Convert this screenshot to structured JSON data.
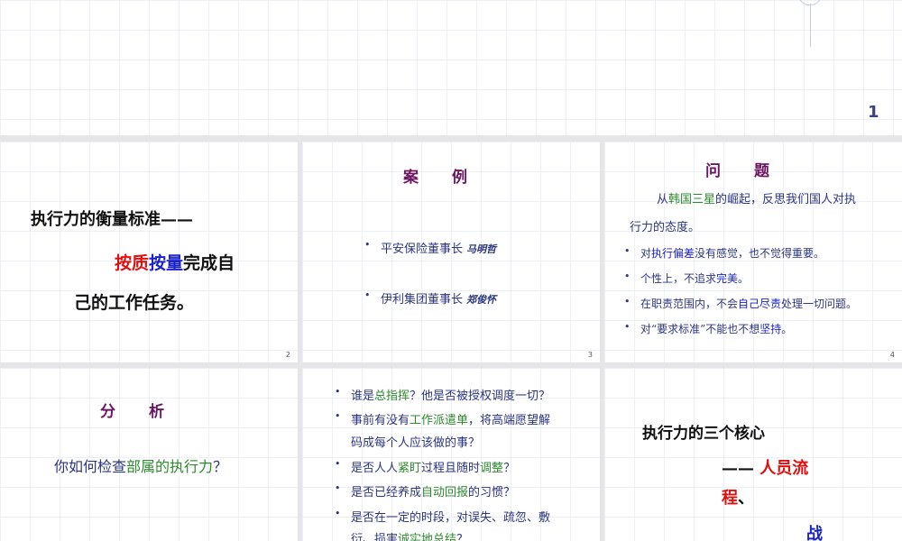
{
  "slides": [
    {
      "number": "1"
    },
    {
      "number": "2",
      "heading": "执行力的衡量标准——",
      "line2": [
        {
          "t": "按质"
        },
        {
          "t": "按量"
        },
        {
          "t": "完成自"
        }
      ],
      "line3": "己的工作任务。"
    },
    {
      "number": "3",
      "title": "案　　例",
      "items": [
        {
          "text": "平安保险董事长",
          "name": "马明哲"
        },
        {
          "text": "伊利集团董事长",
          "name": "郑俊怀"
        }
      ]
    },
    {
      "number": "4",
      "title": "问　　题",
      "intro": [
        "从",
        "韩国三星",
        "的崛起，反思我们国人对执"
      ],
      "intro2": "行力的态度。",
      "items": [
        [
          "对",
          "执行偏差",
          "没有感觉，也不觉得重要。"
        ],
        [
          "个性上，不追求",
          "完美",
          "。"
        ],
        [
          "在职责范围内，不会",
          "自己尽责",
          "处理一切问题。"
        ],
        [
          "对“要求标准”不能也不想",
          "坚持",
          "。"
        ]
      ]
    },
    {
      "title": "分　　析",
      "question": [
        "你如何检查",
        "部属的执行力",
        "？"
      ]
    },
    {
      "items": [
        [
          "谁是",
          "总指挥",
          "？他是否被授权调度一切？"
        ],
        [
          "事前有没有",
          "工作派遣单",
          "，将高端愿望解"
        ],
        [
          "码成每个人应该做的事？"
        ],
        [
          "是否人人",
          "紧盯",
          "过程且随时",
          "调整",
          "？"
        ],
        [
          "是否已经养成",
          "自动回报",
          "的习惯？"
        ],
        [
          "是否在一定的时段，对误失、疏忽、敷"
        ],
        [
          "衍、损害",
          "诚实地总结",
          "？"
        ]
      ]
    },
    {
      "heading": "执行力的三个核心",
      "line2": [
        "—— ",
        "人员流"
      ],
      "line3": [
        "程",
        "、"
      ],
      "line4": "战"
    }
  ],
  "colors": {
    "title": "#6b1660",
    "navy": "#2b3580",
    "green": "#2c8a2c",
    "red": "#e01010",
    "blue": "#1a22c8"
  }
}
